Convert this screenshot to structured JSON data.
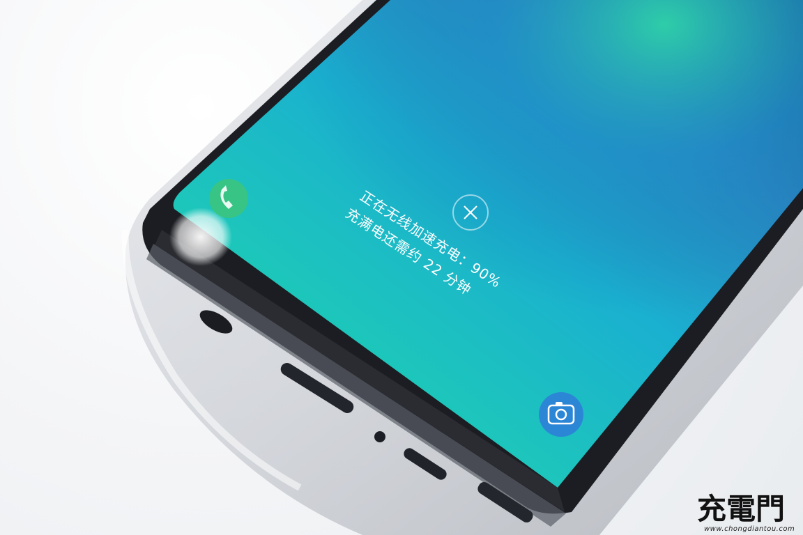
{
  "photo": {
    "description_type": "phone-in-clear-case",
    "wireless_charge_popup": {
      "line1": "正在无线加速充电：90%",
      "line2": "充满电还需约 22 分钟",
      "close_icon": "close-icon",
      "charge_percent": 90
    },
    "left_shortcut_icon": "phone-call-icon",
    "right_shortcut_icon": "camera-icon"
  },
  "watermark": {
    "brand": "充電門",
    "url": "www.chongdiantou.com"
  },
  "colors": {
    "background": "#f4f5f7",
    "screen_teal": "#1ec0c6",
    "screen_blue": "#1f6fae",
    "screen_green": "#2bd39a",
    "phone_frame": "#1b1d22",
    "bezel_bar": "#2a2c31"
  }
}
